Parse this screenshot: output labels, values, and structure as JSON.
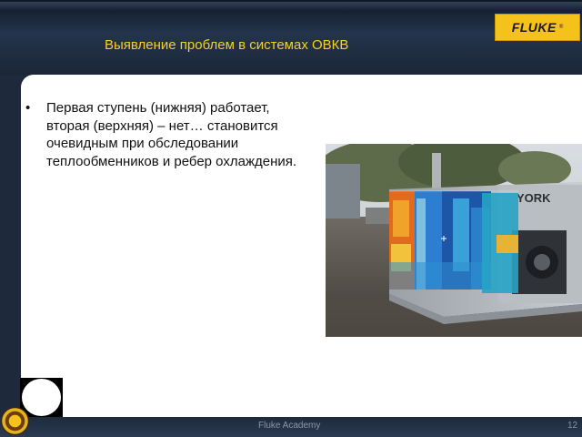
{
  "header": {
    "title": "Выявление проблем в системах ОВКВ",
    "logo_text": "FLUKE",
    "logo_mark": "®"
  },
  "content": {
    "bullets": [
      "Первая ступень (нижняя) работает, вторая (верхняя) – нет… становится очевидным при обследовании теплообменников и ребер охлаждения."
    ],
    "bullet_symbol": "•"
  },
  "photo": {
    "unit_brand": "YORK"
  },
  "footer": {
    "text": "Fluke Academy",
    "page_number": "12"
  },
  "colors": {
    "title": "#f3d12a",
    "logo_bg": "#f4c21a",
    "frame": "#1e2a3c"
  }
}
